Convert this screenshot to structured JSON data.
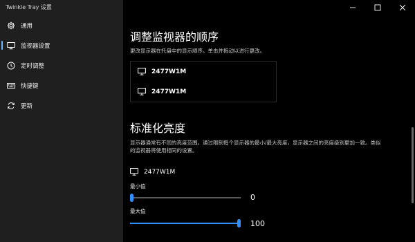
{
  "app": {
    "title": "Twinkle Tray 设置"
  },
  "sidebar": {
    "items": [
      {
        "label": "通用",
        "icon": "gear-icon",
        "active": false
      },
      {
        "label": "监视器设置",
        "icon": "monitor-icon",
        "active": true
      },
      {
        "label": "定时调整",
        "icon": "clock-icon",
        "active": false
      },
      {
        "label": "快捷键",
        "icon": "keyboard-icon",
        "active": false
      },
      {
        "label": "更新",
        "icon": "refresh-icon",
        "active": false
      }
    ]
  },
  "reorder": {
    "title": "调整监视器的顺序",
    "description": "更改显示器在托盘中的显示顺序。单击并拖动以进行更改。",
    "monitors": [
      "2477W1M",
      "2477W1M"
    ]
  },
  "normalize": {
    "title": "标准化亮度",
    "description_line1": "显示器通常有不同的亮度范围。通过限制每个显示器的最小/最大亮度，显示器之间的亮度级别更加一致。类似",
    "description_line2": "的监视器将使用相同的设置。",
    "monitor": {
      "name": "2477W1M",
      "min_label": "最小值",
      "min_value": "0",
      "max_label": "最大值",
      "max_value": "100"
    }
  },
  "colors": {
    "accent": "#2f8fff",
    "sidebar_bg": "#1f1f1f",
    "main_bg": "#000000"
  }
}
